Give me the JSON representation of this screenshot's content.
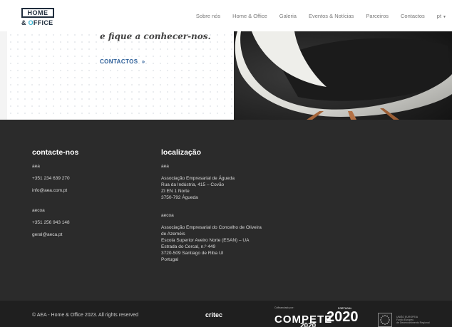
{
  "header": {
    "logo_top": "HOME",
    "logo_bottom_pre": "& ",
    "logo_bottom_o": "O",
    "logo_bottom_post": "FFICE",
    "nav": [
      {
        "label": "Sobre nós"
      },
      {
        "label": "Home & Office"
      },
      {
        "label": "Galeria"
      },
      {
        "label": "Eventos & Notícias"
      },
      {
        "label": "Parceiros"
      },
      {
        "label": "Contactos"
      },
      {
        "label": "pt"
      }
    ]
  },
  "hero": {
    "tagline": "e fique a conhecer-nos.",
    "cta_label": "CONTACTOS",
    "cta_arrow": "»"
  },
  "footer": {
    "contact": {
      "heading": "contacte-nos",
      "org1": "aea",
      "phone1": "+351 234 639 270",
      "email1": "info@aea.com.pt",
      "org2": "aecoa",
      "phone2": "+351 256 943 148",
      "email2": "geral@aeca.pt"
    },
    "location": {
      "heading": "localização",
      "org1": "aea",
      "addr1": [
        "Associação Empresarial de Águeda",
        "Rua da Indústria, 415 – Covão",
        "ZI EN 1 Norte",
        "3750-792 Águeda"
      ],
      "org2": "aecoa",
      "addr2": [
        "Associação Empresarial do Concelho de Oliveira",
        "de Azeméis",
        "Escola Superior Aveiro Norte (ESAN) – UA",
        "Estrada do Cercal, n.º 449",
        "3720-509 Santiago de Riba Ul",
        "Portugal"
      ]
    }
  },
  "bottom": {
    "copyright": "© AEA - Home & Office 2023. All rights reserved",
    "critec": "critec",
    "cofinanced": "Cofinanciado por:",
    "compete": "COMPETE",
    "compete_year": "2020",
    "portugal_small": "PORTUGAL",
    "p2020": "2020",
    "eu_text": [
      "UNIÃO EUROPEIA",
      "Fundo Europeu",
      "de Desenvolvimento Regional"
    ]
  },
  "colors": {
    "footer_bg": "#2b2b2b",
    "bottom_bg": "#1f1f1f",
    "cta": "#2d5f99",
    "logo_accent": "#3cb8d6"
  }
}
